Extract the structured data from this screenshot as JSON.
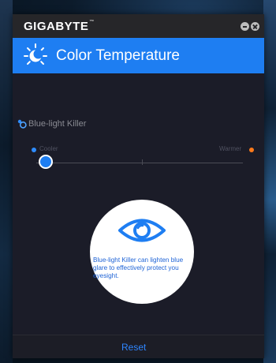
{
  "app": {
    "brand": "GIGABYTE",
    "brand_tm": "™"
  },
  "window_controls": {
    "minimize_icon": "minimize-icon",
    "close_icon": "close-icon"
  },
  "header": {
    "title": "Color Temperature",
    "icon": "moon-sun-icon"
  },
  "blue_light_killer": {
    "label": "Blue-light Killer",
    "icon": "toggle-dots-icon",
    "cooler_label": "Cooler",
    "warmer_label": "Warmer",
    "slider_value": 0.0
  },
  "info": {
    "icon": "eye-icon",
    "text": "Blue-light Killer can lighten blue glare to effectively protect you eyesight."
  },
  "footer": {
    "reset_label": "Reset"
  },
  "colors": {
    "accent": "#1e7ef2",
    "warm": "#ff7a1a",
    "panel": "#1b1c28",
    "info_text": "#1e63d6"
  }
}
